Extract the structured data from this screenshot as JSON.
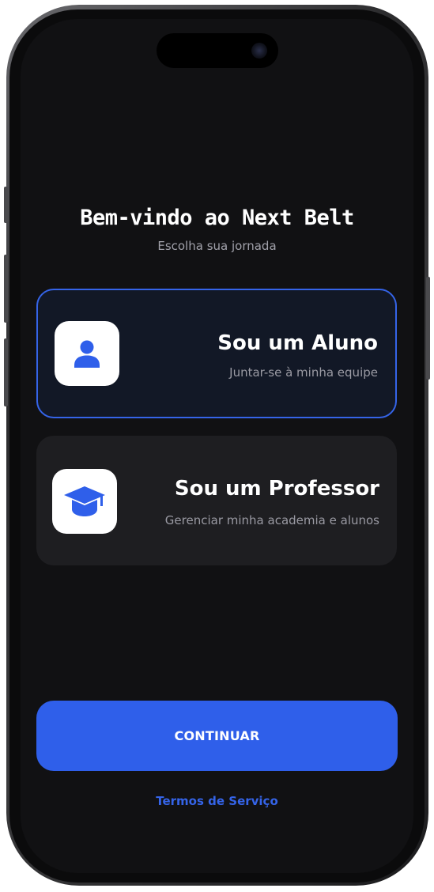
{
  "header": {
    "title": "Bem-vindo ao Next Belt",
    "subtitle": "Escolha sua jornada"
  },
  "options": [
    {
      "title": "Sou um Aluno",
      "subtitle": "Juntar-se à minha equipe",
      "icon": "person-icon",
      "selected": true
    },
    {
      "title": "Sou um Professor",
      "subtitle": "Gerenciar minha academia e alunos",
      "icon": "graduation-cap-icon",
      "selected": false
    }
  ],
  "actions": {
    "continue_label": "CONTINUAR",
    "terms_label": "Termos de Serviço"
  },
  "colors": {
    "accent": "#2f5fea",
    "background": "#111113",
    "card_selected_bg": "#121826",
    "card_bg": "#1e1e21"
  }
}
